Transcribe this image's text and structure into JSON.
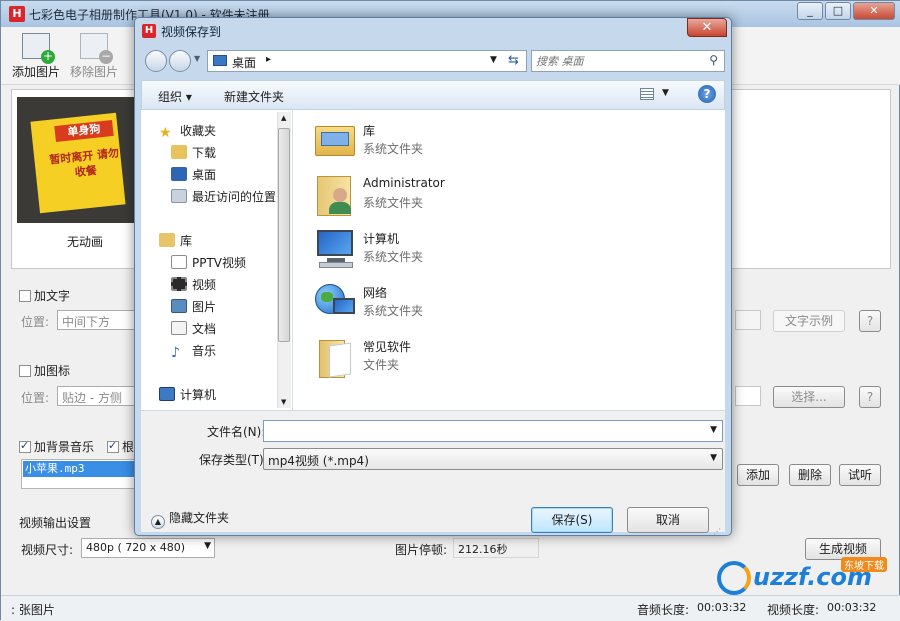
{
  "main": {
    "title": "七彩色电子相册制作工具(V1.0) - 软件未注册",
    "controls": {
      "minimize": "_",
      "restore": "□",
      "close": "✕"
    },
    "toolbar": [
      {
        "label": "添加图片",
        "icon": "add-image-icon"
      },
      {
        "label": "移除图片",
        "icon": "remove-image-icon"
      }
    ],
    "thumbnail": {
      "sign_line1": "单身狗",
      "sign_line2": "暂时离开 请勿收餐",
      "caption": "无动画"
    },
    "text_section": {
      "checkbox_label": "加文字",
      "position_label": "位置:",
      "position_value": "中间下方",
      "sample_button": "文字示例",
      "help_button": "?"
    },
    "logo_section": {
      "checkbox_label": "加图标",
      "position_label": "位置:",
      "position_value": "贴边  - 方侧",
      "choose_button": "选择...",
      "help_button": "?"
    },
    "music_section": {
      "checkbox_label": "加背景音乐",
      "checkbox2_label": "根",
      "file": "小苹果.mp3",
      "add_button": "添加",
      "delete_button": "删除",
      "listen_button": "试听"
    },
    "output": {
      "header": "视频输出设置",
      "size_label": "视频尺寸:",
      "size_value": "480p ( 720 x  480)",
      "pause_label": "图片停顿:",
      "pause_value": "212.16秒",
      "generate_button": "生成视频"
    },
    "status": {
      "count": ": 张图片",
      "audio_len_label": "音频长度:",
      "audio_len_value": "00:03:32",
      "video_len_label": "视频长度:",
      "video_len_value": "00:03:32"
    },
    "watermark": {
      "text": "uzzf.com",
      "sub": "东坡下载"
    }
  },
  "dialog": {
    "title": "视频保存到",
    "close": "✕",
    "address": "桌面",
    "address_sep": "▸",
    "search_placeholder": "搜索 桌面",
    "organize": "组织 ▾",
    "new_folder": "新建文件夹",
    "help": "?",
    "nav_items": [
      {
        "label": "收藏夹",
        "icon": "star-icon"
      },
      {
        "label": "下载",
        "icon": "download-folder-icon"
      },
      {
        "label": "桌面",
        "icon": "desktop-icon"
      },
      {
        "label": "最近访问的位置",
        "icon": "recent-places-icon"
      },
      {
        "label": "库",
        "icon": "library-icon"
      },
      {
        "label": "PPTV视频",
        "icon": "pptv-icon"
      },
      {
        "label": "视频",
        "icon": "video-icon"
      },
      {
        "label": "图片",
        "icon": "picture-icon"
      },
      {
        "label": "文档",
        "icon": "document-icon"
      },
      {
        "label": "音乐",
        "icon": "music-icon"
      },
      {
        "label": "计算机",
        "icon": "computer-icon"
      }
    ],
    "items": [
      {
        "name": "库",
        "type": "系统文件夹",
        "icon": "library-folder-icon"
      },
      {
        "name": "Administrator",
        "type": "系统文件夹",
        "icon": "user-folder-icon"
      },
      {
        "name": "计算机",
        "type": "系统文件夹",
        "icon": "computer-icon"
      },
      {
        "name": "网络",
        "type": "系统文件夹",
        "icon": "network-icon"
      },
      {
        "name": "常见软件",
        "type": "文件夹",
        "icon": "folder-icon"
      }
    ],
    "filename_label": "文件名(N):",
    "filename_value": "",
    "filetype_label": "保存类型(T):",
    "filetype_value": "mp4视频 (*.mp4)",
    "hide_folders": "隐藏文件夹",
    "save_button": "保存(S)",
    "cancel_button": "取消"
  }
}
